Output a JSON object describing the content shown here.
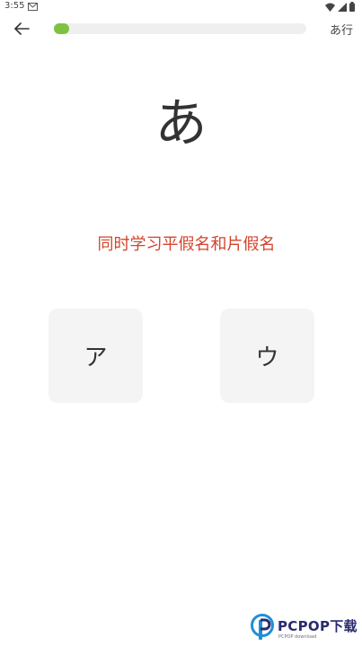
{
  "status_bar": {
    "time": "3:55",
    "icons": [
      "gmail-icon",
      "wifi-icon",
      "signal-icon",
      "battery-icon"
    ]
  },
  "top_bar": {
    "back_icon": "arrow-left-icon",
    "progress_fraction": 0.06,
    "progress_color": "#7ec242",
    "row_label": "あ行"
  },
  "question": {
    "character": "あ",
    "hint": "同时学习平假名和片假名"
  },
  "options": [
    {
      "label": "ア"
    },
    {
      "label": "ウ"
    }
  ],
  "colors": {
    "accent_green": "#7ec242",
    "hint_red": "#d4442c",
    "card_bg": "#f4f4f4"
  },
  "watermark": {
    "brand": "PCPOP下载",
    "sub": "PCPOP download"
  }
}
